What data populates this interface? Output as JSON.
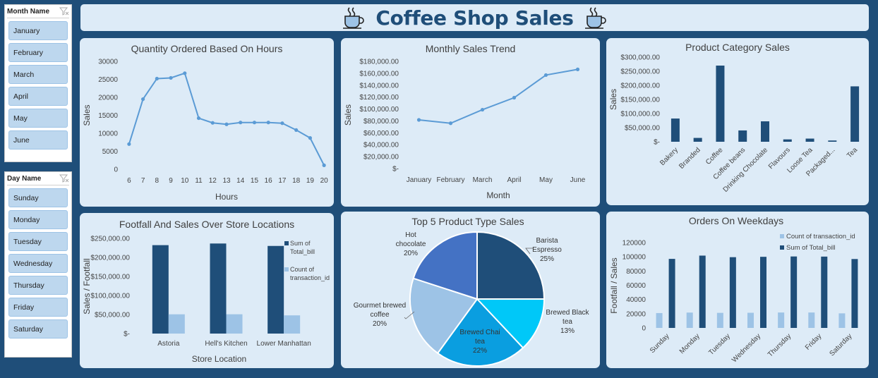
{
  "dashboard": {
    "title": "Coffee Shop Sales",
    "cup_icon": "coffee-cup-icon"
  },
  "month_slicer": {
    "title": "Month Name",
    "items": [
      "January",
      "February",
      "March",
      "April",
      "May",
      "June"
    ]
  },
  "day_slicer": {
    "title": "Day Name",
    "items": [
      "Sunday",
      "Monday",
      "Tuesday",
      "Wednesday",
      "Thursday",
      "Friday",
      "Saturday"
    ]
  },
  "colors": {
    "background": "#1f4e79",
    "card": "#ddebf7",
    "dark_blue": "#1f4e79",
    "light_blue": "#9dc3e6",
    "line": "#5b9bd5"
  },
  "chart_data": [
    {
      "id": "hours",
      "type": "line",
      "title": "Quantity Ordered Based On Hours",
      "xlabel": "Hours",
      "ylabel": "Sales",
      "ylim": [
        0,
        30000
      ],
      "yticks": [
        "0",
        "5000",
        "10000",
        "15000",
        "20000",
        "25000",
        "30000"
      ],
      "categories": [
        "6",
        "7",
        "8",
        "9",
        "10",
        "11",
        "12",
        "13",
        "14",
        "15",
        "16",
        "17",
        "18",
        "19",
        "20"
      ],
      "values": [
        7000,
        19500,
        25200,
        25400,
        26700,
        14200,
        12900,
        12500,
        13000,
        13000,
        13000,
        12800,
        10900,
        8700,
        1100
      ]
    },
    {
      "id": "monthly",
      "type": "line",
      "title": "Monthly Sales Trend",
      "xlabel": "Month",
      "ylabel": "Sales",
      "ylim": [
        0,
        180000
      ],
      "yticks": [
        "$-",
        "$20,000.00",
        "$40,000.00",
        "$60,000.00",
        "$80,000.00",
        "$100,000.00",
        "$120,000.00",
        "$140,000.00",
        "$160,000.00",
        "$180,000.00"
      ],
      "categories": [
        "January",
        "February",
        "March",
        "April",
        "May",
        "June"
      ],
      "values": [
        81700,
        76100,
        98800,
        119000,
        157000,
        166500
      ]
    },
    {
      "id": "category",
      "type": "bar",
      "title": "Product Category Sales",
      "xlabel": "",
      "ylabel": "Sales",
      "ylim": [
        0,
        300000
      ],
      "yticks": [
        "$-",
        "$50,000.00",
        "$100,000.00",
        "$150,000.00",
        "$200,000.00",
        "$250,000.00",
        "$300,000.00"
      ],
      "categories": [
        "Bakery",
        "Branded",
        "Coffee",
        "Coffee beans",
        "Drinking Chocolate",
        "Flavours",
        "Loose Tea",
        "Packaged...",
        "Tea"
      ],
      "values": [
        82300,
        13600,
        270000,
        40100,
        72400,
        8400,
        11200,
        4400,
        196400
      ]
    },
    {
      "id": "footfall",
      "type": "bar",
      "title": "Footfall And Sales Over Store Locations",
      "xlabel": "Store Location",
      "ylabel": "Sales / Footfall",
      "ylim": [
        0,
        250000
      ],
      "yticks": [
        "$-",
        "$50,000.00",
        "$100,000.00",
        "$150,000.00",
        "$200,000.00",
        "$250,000.00"
      ],
      "categories": [
        "Astoria",
        "Hell's Kitchen",
        "Lower Manhattan"
      ],
      "series": [
        {
          "name": "Sum of Total_bill",
          "values": [
            232200,
            236500,
            230100
          ]
        },
        {
          "name": "Count of transaction_id",
          "values": [
            50600,
            50700,
            47800
          ]
        }
      ],
      "legend": [
        "Sum of",
        "Total_bill",
        "Count of",
        "transaction_id"
      ]
    },
    {
      "id": "top5",
      "type": "pie",
      "title": "Top 5 Product Type Sales",
      "slices": [
        {
          "label": "Barista Espresso",
          "lines": [
            "Barista",
            "Espresso",
            "25%"
          ],
          "value": 25
        },
        {
          "label": "Brewed Black tea",
          "lines": [
            "Brewed Black",
            "tea",
            "13%"
          ],
          "value": 13
        },
        {
          "label": "Brewed Chai tea",
          "lines": [
            "Brewed Chai",
            "tea",
            "22%"
          ],
          "value": 22
        },
        {
          "label": "Gourmet brewed coffee",
          "lines": [
            "Gourmet brewed",
            "coffee",
            "20%"
          ],
          "value": 20
        },
        {
          "label": "Hot chocolate",
          "lines": [
            "Hot",
            "chocolate",
            "20%"
          ],
          "value": 20
        }
      ]
    },
    {
      "id": "weekdays",
      "type": "bar",
      "title": "Orders On Weekdays",
      "xlabel": "",
      "ylabel": "Footfall / Sales",
      "ylim": [
        0,
        120000
      ],
      "yticks": [
        "0",
        "20000",
        "40000",
        "60000",
        "80000",
        "100000",
        "120000"
      ],
      "categories": [
        "Sunday",
        "Monday",
        "Tuesday",
        "Wednesday",
        "Thursday",
        "Friday",
        "Saturday"
      ],
      "series": [
        {
          "name": "Count of transaction_id",
          "values": [
            20900,
            21600,
            21200,
            21300,
            21700,
            21700,
            20500
          ]
        },
        {
          "name": "Sum of Total_bill",
          "values": [
            97100,
            101700,
            99500,
            100000,
            100500,
            100300,
            96900
          ]
        }
      ],
      "legend": [
        "Count of transaction_id",
        "Sum of Total_bill"
      ]
    }
  ]
}
